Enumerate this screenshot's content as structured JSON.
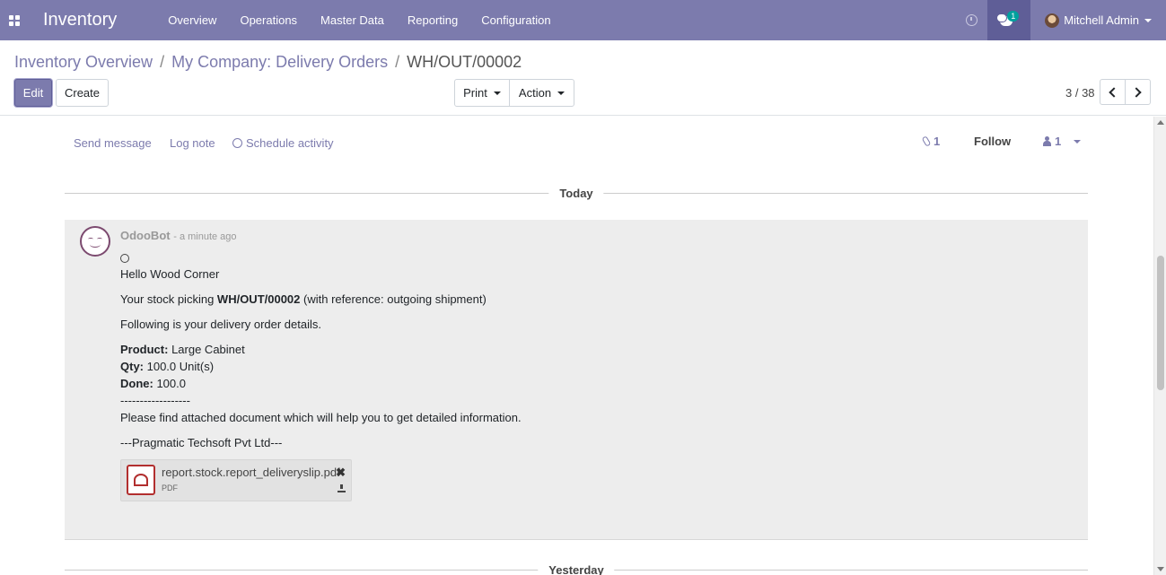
{
  "navbar": {
    "app_title": "Inventory",
    "menu": [
      "Overview",
      "Operations",
      "Master Data",
      "Reporting",
      "Configuration"
    ],
    "chat_badge": "1",
    "user_name": "Mitchell Admin"
  },
  "breadcrumb": {
    "items": [
      "Inventory Overview",
      "My Company: Delivery Orders"
    ],
    "separator": "/",
    "current": "WH/OUT/00002"
  },
  "toolbar": {
    "edit_label": "Edit",
    "create_label": "Create",
    "print_label": "Print",
    "action_label": "Action",
    "pager": "3 / 38"
  },
  "chatter": {
    "send_message": "Send message",
    "log_note": "Log note",
    "schedule_activity": "Schedule activity",
    "attachments_count": "1",
    "follow_label": "Follow",
    "followers_count": "1"
  },
  "separators": {
    "today": "Today",
    "yesterday": "Yesterday"
  },
  "message": {
    "author": "OdooBot",
    "time": "- a minute ago",
    "greeting": "Hello Wood Corner",
    "picking_prefix": "Your stock picking ",
    "picking_ref": "WH/OUT/00002",
    "picking_suffix": " (with reference: outgoing shipment)",
    "details_intro": "Following is your delivery order details.",
    "product_label": "Product:",
    "product_value": " Large Cabinet",
    "qty_label": "Qty:",
    "qty_value": " 100.0 Unit(s)",
    "done_label": "Done:",
    "done_value": " 100.0",
    "divider": "------------------",
    "attached_note": "Please find attached document which will help you to get detailed information.",
    "signature": "---Pragmatic Techsoft Pvt Ltd---",
    "attachment_name": "report.stock.report_deliveryslip.pdf",
    "attachment_ext": "PDF"
  },
  "colors": {
    "brand": "#7c7bad",
    "brand_dark": "#5f5e97",
    "badge": "#00a09d",
    "pdf_red": "#b22f2f"
  }
}
